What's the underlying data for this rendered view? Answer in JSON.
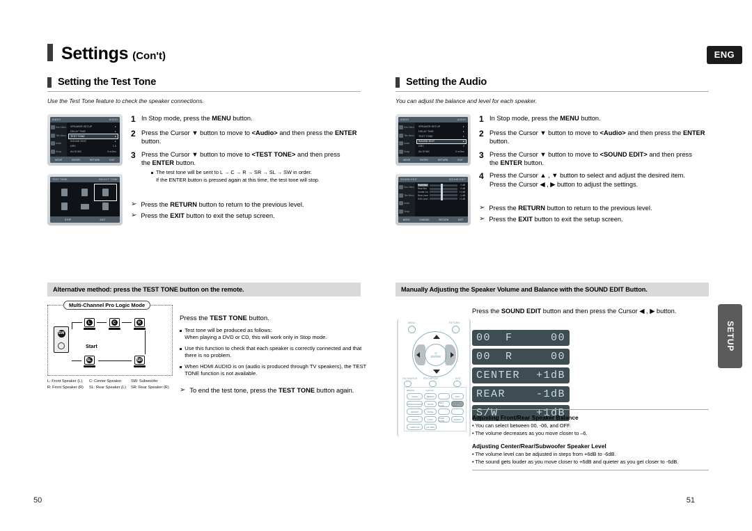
{
  "header": {
    "title_main": "Settings",
    "title_sub": "(Con't)",
    "lang_badge": "ENG",
    "side_tab": "SETUP"
  },
  "left": {
    "section_title": "Setting the Test Tone",
    "section_note": "Use the Test Tone feature to check the speaker connections.",
    "steps": [
      {
        "n": "1",
        "text": "In Stop mode, press the MENU button."
      },
      {
        "n": "2",
        "text": "Press the Cursor ▼ button to move to <Audio> and then press the ENTER button."
      },
      {
        "n": "3",
        "text": "Press the Cursor ▼ button to move to <TEST TONE> and then press the ENTER button."
      }
    ],
    "sub_bullet": "The test tone will be sent to L → C → R → SR → SL → SW in order.",
    "sub_cont": "If the ENTER button is pressed again at this time, the test tone will stop.",
    "arrows": [
      "Press the RETURN button to return to the previous level.",
      "Press the EXIT button to exit the setup screen."
    ],
    "tv_screens": [
      {
        "top_left": "AUDIO",
        "top_right": "AUDIO",
        "side_items": [
          "Disc Menu",
          "Title Menu",
          "Audio",
          "Setup"
        ],
        "rows": [
          {
            "label": "SPEAKER SETUP",
            "value": "▸",
            "selected": false
          },
          {
            "label": "DELAY TIME",
            "value": "▸",
            "selected": false
          },
          {
            "label": "TEST TONE",
            "value": "▸",
            "selected": true
          },
          {
            "label": "SOUND EDIT",
            "value": "▸",
            "selected": false
          },
          {
            "label": "DRC",
            "value": "1.0",
            "selected": false
          },
          {
            "label": "AV-SYNC",
            "value": "0 mSec",
            "selected": false
          }
        ],
        "bottom": [
          "MOVE",
          "ENTER",
          "RETURN",
          "EXIT"
        ]
      },
      {
        "top_left": "TEST TONE",
        "top_right": "SELECT TONE",
        "speakers": [
          "L",
          "C",
          "R",
          "SL",
          "SW",
          "SR"
        ],
        "highlight_index": 2,
        "bottom": [
          "STOP",
          "EXIT"
        ]
      }
    ],
    "band": "Alternative method: press the TEST TONE button on the remote.",
    "diagram": {
      "caption": "Multi-Channel Pro Logic Mode",
      "start_label": "Start",
      "speakers": {
        "l": "L",
        "c": "C",
        "r": "R",
        "sl": "SL",
        "sr": "SR",
        "sw": "SW"
      },
      "legend": [
        [
          "L: Front Speaker (L)",
          "C: Center Speaker",
          "SW: Subwoofer"
        ],
        [
          "R: Front Speaker (R)",
          "SL: Rear Speaker (L)",
          "SR: Rear Speaker (R)"
        ]
      ]
    },
    "alt_title": "Press the TEST TONE button.",
    "alt_bullets": [
      "Test tone will be produced as follows:\nWhen playing a DVD or CD, this will work only in Stop mode.",
      "Use this function to check that each speaker is correctly connected and that there is no problem.",
      "When HDMI AUDIO is on (audio is produced through TV speakers), the TEST TONE function is not available."
    ],
    "alt_arrow": "To end the test tone, press the TEST TONE button again.",
    "page_number": "50"
  },
  "right": {
    "section_title": "Setting the Audio",
    "section_note": "You can adjust the balance and level for each speaker.",
    "steps": [
      {
        "n": "1",
        "text": "In Stop mode, press the MENU button."
      },
      {
        "n": "2",
        "text": "Press the Cursor ▼ button to move to <Audio> and then press the ENTER button."
      },
      {
        "n": "3",
        "text": "Press the Cursor ▼ button to move to <SOUND EDIT> and then press the ENTER button."
      },
      {
        "n": "4",
        "text": "Press the Cursor ▲ , ▼ button to select and adjust the desired item. Press the Cursor ◀ , ▶ button to adjust the settings."
      }
    ],
    "arrows": [
      "Press the RETURN button to return to the previous level.",
      "Press the EXIT button to exit the setup screen."
    ],
    "tv_screens": [
      {
        "top_left": "AUDIO",
        "top_right": "AUDIO",
        "side_items": [
          "Disc Menu",
          "Title Menu",
          "Audio",
          "Setup"
        ],
        "rows": [
          {
            "label": "SPEAKER SETUP",
            "value": "▸",
            "selected": false
          },
          {
            "label": "DELAY TIME",
            "value": "▸",
            "selected": false
          },
          {
            "label": "TEST TONE",
            "value": "▸",
            "selected": false
          },
          {
            "label": "SOUND EDIT",
            "value": "▸",
            "selected": true
          },
          {
            "label": "DRC",
            "value": "2",
            "selected": false
          },
          {
            "label": "AV-SYNC",
            "value": "0 mSec",
            "selected": false
          }
        ],
        "bottom": [
          "MOVE",
          "ENTER",
          "RETURN",
          "EXIT"
        ]
      },
      {
        "top_left": "SOUND EDIT",
        "top_right": "SOUND EDIT",
        "side_items": [
          "Disc Menu",
          "Title Menu",
          "Audio",
          "Setup"
        ],
        "sliders": [
          {
            "label": "Front Bal.",
            "value": "0 dB",
            "selected": true
          },
          {
            "label": "Rear Bal.",
            "value": "0 dB",
            "selected": false
          },
          {
            "label": "Center Level",
            "value": "+1 dB",
            "selected": false
          },
          {
            "label": "Rear Level",
            "value": "-1 dB",
            "selected": false
          },
          {
            "label": "S/W Level",
            "value": "+1 dB",
            "selected": false
          }
        ],
        "bottom": [
          "MOVE",
          "CHANGE",
          "RETURN",
          "EXIT"
        ]
      }
    ],
    "band": "Manually Adjusting the Speaker Volume and Balance with the SOUND EDIT Button.",
    "sound_lead": "Press the SOUND EDIT button and then press the Cursor ◀ , ▶ button.",
    "lcd_displays": [
      {
        "left": "00  F",
        "right": "00"
      },
      {
        "left": "00  R",
        "right": "00"
      },
      {
        "left": "CENTER",
        "right": "+1dB"
      },
      {
        "left": "REAR",
        "right": "-1dB"
      },
      {
        "left": "S/W",
        "right": "+1dB"
      }
    ],
    "remote": {
      "label_menu": "MENU",
      "label_return": "RETURN",
      "label_enter": "ENTER",
      "label_fm_search": "FM SEARCH",
      "label_fm_display": "FM DISPLAY",
      "label_exit": "EXIT",
      "label_remain": "REMAIN",
      "label_cancel": "CANCEL",
      "keys": [
        "MODE",
        "REPEAT",
        "",
        "INFO",
        "PROG/RANDOM",
        "SLOW",
        "TEST TONE",
        "SOUND EDIT",
        "REPEAT",
        "MODE",
        "",
        "",
        "ZOOM",
        "LOGO",
        "SLIDE MODE",
        "DIGEST",
        "SUBTITLE",
        "EZ VIEW",
        "",
        ""
      ],
      "dark_key_index": 7
    },
    "adjust_blocks": [
      {
        "heading": "Adjusting Front/Rear Speaker Balance",
        "lines": [
          "• You can select between 00, -06, and OFF.",
          "• The volume decreases as you move closer to –6."
        ]
      },
      {
        "heading": "Adjusting Center/Rear/Subwoofer Speaker Level",
        "lines": [
          "• The volume level can be adjusted in steps from +6dB to -6dB.",
          "• The sound gets louder as you move closer to +6dB and quieter as you get closer to -6dB."
        ]
      }
    ],
    "page_number": "51"
  }
}
